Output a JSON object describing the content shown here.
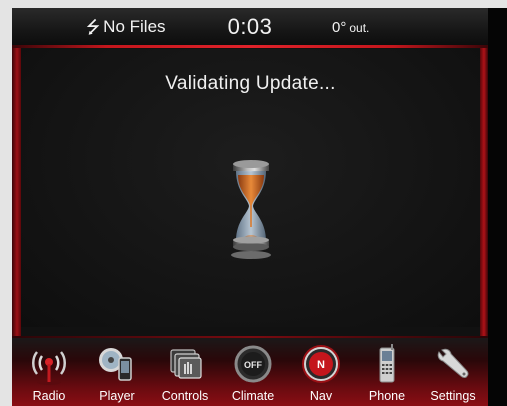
{
  "status_bar": {
    "usb_icon": "usb-icon",
    "media_status": "No Files",
    "clock": "0:03",
    "outside_temp_value": "0°",
    "outside_temp_label": "out."
  },
  "main": {
    "message": "Validating Update...",
    "icon": "hourglass-icon"
  },
  "nav": {
    "items": [
      {
        "label": "Radio",
        "icon": "radio-icon"
      },
      {
        "label": "Player",
        "icon": "player-icon"
      },
      {
        "label": "Controls",
        "icon": "controls-icon"
      },
      {
        "label": "Climate",
        "icon": "climate-icon",
        "badge": "OFF"
      },
      {
        "label": "Nav",
        "icon": "nav-compass-icon",
        "badge": "N"
      },
      {
        "label": "Phone",
        "icon": "phone-icon"
      },
      {
        "label": "Settings",
        "icon": "settings-wrench-icon"
      }
    ]
  },
  "colors": {
    "accent_red": "#c4161c",
    "sand": "#d97a2e",
    "background": "#111111"
  }
}
